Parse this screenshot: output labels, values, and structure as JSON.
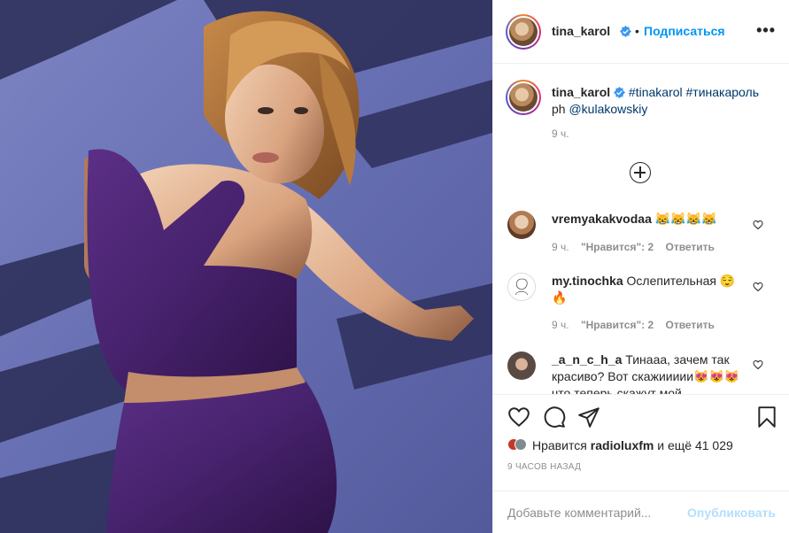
{
  "post": {
    "author": "tina_karol",
    "follow_label": "Подписаться",
    "separator": "•",
    "more_label": "•••"
  },
  "caption": {
    "author": "tina_karol",
    "hashtag1": "#tinakarol",
    "hashtag2": "#тинакароль",
    "ph_prefix": "ph ",
    "mention": "@kulakowskiy",
    "time": "9 ч."
  },
  "comments": [
    {
      "user": "vremyakakvodaa",
      "text": "😹😹😹😹",
      "time": "9 ч.",
      "likes": "\"Нравится\": 2",
      "reply": "Ответить"
    },
    {
      "user": "my.tinochka",
      "text": "Ослепительная 😌🔥",
      "time": "9 ч.",
      "likes": "\"Нравится\": 2",
      "reply": "Ответить"
    },
    {
      "user": "_a_n_c_h_a",
      "text": "Тинааа, зачем так красиво? Вот скажиииии😻😻😻 что теперь скажут мой",
      "time": "",
      "likes": "",
      "reply": ""
    }
  ],
  "likes": {
    "prefix": "Нравится ",
    "user": "radioluxfm",
    "suffix": " и ещё 41 029"
  },
  "time_ago": "9 ЧАСОВ НАЗАД",
  "add_comment": {
    "placeholder": "Добавьте комментарий...",
    "post_label": "Опубликовать"
  },
  "colors": {
    "accent": "#0095f6",
    "verified": "#3897f0",
    "post_disabled": "#b2dffc",
    "muted": "#8e8e8e"
  }
}
